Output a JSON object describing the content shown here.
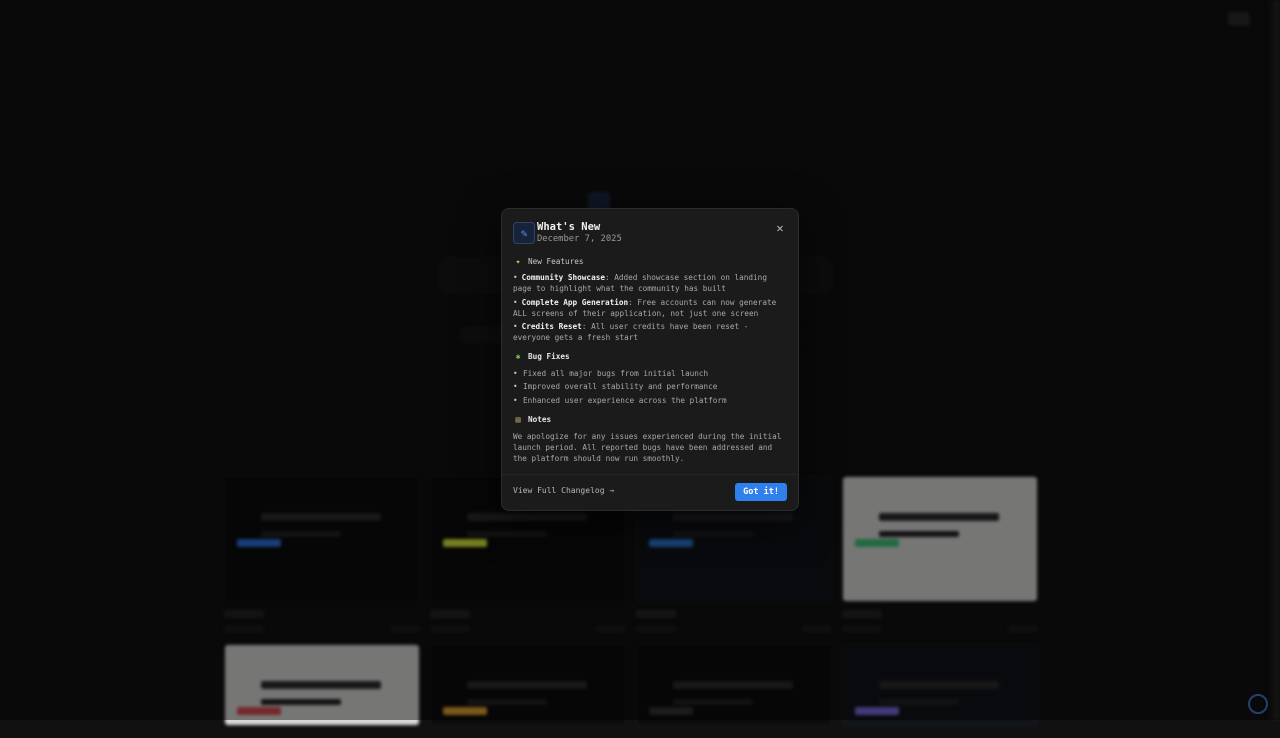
{
  "background": {
    "brand": "",
    "cards_row1": [
      {
        "accent": "#2a6fdb",
        "theme": "dark"
      },
      {
        "accent": "#d8e63a",
        "theme": "dark"
      },
      {
        "accent": "#2a7bd6",
        "theme": "dark2"
      },
      {
        "accent": "#3fbf7a",
        "theme": "light"
      }
    ],
    "cards_row2": [
      {
        "accent": "#d84a4a",
        "theme": "light"
      },
      {
        "accent": "#e0a030",
        "theme": "dark"
      },
      {
        "accent": "#333333",
        "theme": "dark"
      },
      {
        "accent": "#7a6ae0",
        "theme": "dark2"
      }
    ]
  },
  "modal": {
    "icon": "pencil-icon",
    "title": "What's New",
    "date": "December 7, 2025",
    "close_icon": "close-icon",
    "features": {
      "heading": "New Features",
      "icon": "sparkle-icon",
      "items": [
        {
          "name": "Community Showcase",
          "desc": ": Added showcase section on landing page to highlight what the community has built"
        },
        {
          "name": "Complete App Generation",
          "desc": ": Free accounts can now generate ALL screens of their application, not just one screen"
        },
        {
          "name": "Credits Reset",
          "desc": ": All user credits have been reset - everyone gets a fresh start"
        }
      ]
    },
    "bug_fixes": {
      "heading": "Bug Fixes",
      "icon": "bug-icon",
      "items": [
        "Fixed all major bugs from initial launch",
        "Improved overall stability and performance",
        "Enhanced user experience across the platform"
      ]
    },
    "notes": {
      "heading": "Notes",
      "icon": "memo-icon",
      "text": "We apologize for any issues experienced during the initial launch period. All reported bugs have been addressed and the platform should now run smoothly."
    },
    "footer": {
      "changelog_label": "View Full Changelog →",
      "confirm_label": "Got it!"
    },
    "accent_color": "#2f80ed"
  }
}
